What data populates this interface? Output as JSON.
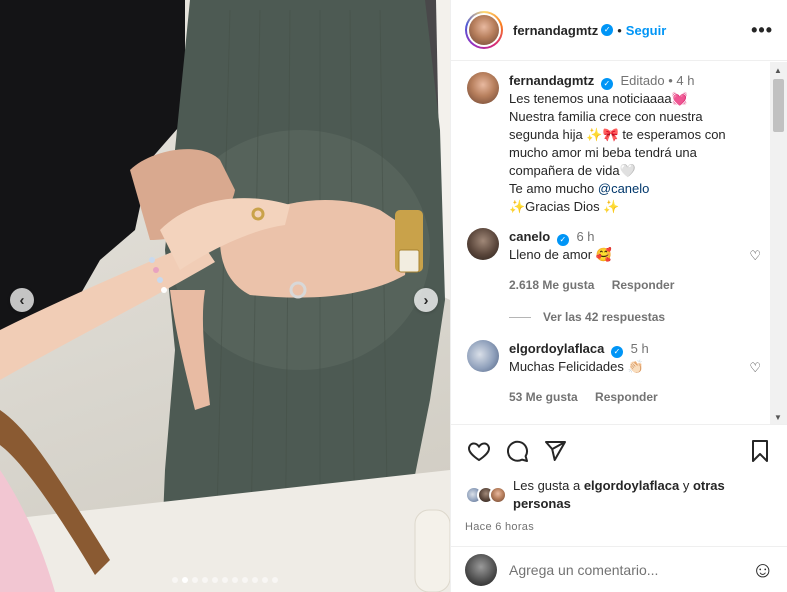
{
  "post": {
    "username": "fernandagmtz",
    "follow_label": "Seguir",
    "separator": "•",
    "more_label": "•••",
    "edited_label": "Editado",
    "time_ago": "4 h",
    "caption": [
      "Les tenemos una noticiaaaa💓",
      "Nuestra familia crece con nuestra",
      "segunda hija ✨🎀 te esperamos con",
      "mucho amor mi beba tendrá una",
      "compañera de vida🤍",
      "Te amo mucho @canelo",
      "✨Gracias Dios ✨"
    ],
    "caption_mention": "@canelo",
    "carousel": {
      "total": 11,
      "active_index": 1
    }
  },
  "comments": [
    {
      "username": "canelo",
      "time_ago": "6 h",
      "text": "Lleno de amor 🥰",
      "likes": "2.618 Me gusta",
      "reply_label": "Responder",
      "replies_label": "Ver las 42 respuestas"
    },
    {
      "username": "elgordoylaflaca",
      "time_ago": "5 h",
      "text": "Muchas Felicidades 👏🏻",
      "likes": "53 Me gusta",
      "reply_label": "Responder"
    }
  ],
  "likes_summary": {
    "prefix": "Les gusta a ",
    "user": "elgordoylaflaca",
    "connector": " y ",
    "others": "otras personas"
  },
  "posted_time": "Hace 6 horas",
  "comment_input": {
    "placeholder": "Agrega un comentario..."
  },
  "icons": [
    "heart-icon",
    "comment-icon",
    "share-icon",
    "save-icon",
    "emoji-icon",
    "verified-icon",
    "more-icon"
  ],
  "colors": {
    "accent": "#0095f6",
    "text": "#262626",
    "muted": "#737373"
  }
}
